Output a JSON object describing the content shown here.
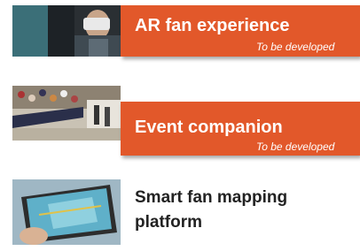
{
  "cards": [
    {
      "title": "AR fan experience",
      "subtitle": "To be developed",
      "image_icon": "vr-headset-person-photo",
      "style": "orange-banner"
    },
    {
      "title": "Event companion",
      "subtitle": "To be developed",
      "image_icon": "stadium-crowd-photo",
      "style": "orange-banner"
    },
    {
      "title": "Smart fan mapping platform",
      "image_icon": "tablet-map-photo",
      "style": "plain"
    }
  ],
  "colors": {
    "accent": "#e2582a",
    "text_dark": "#222222",
    "text_light": "#ffffff"
  }
}
